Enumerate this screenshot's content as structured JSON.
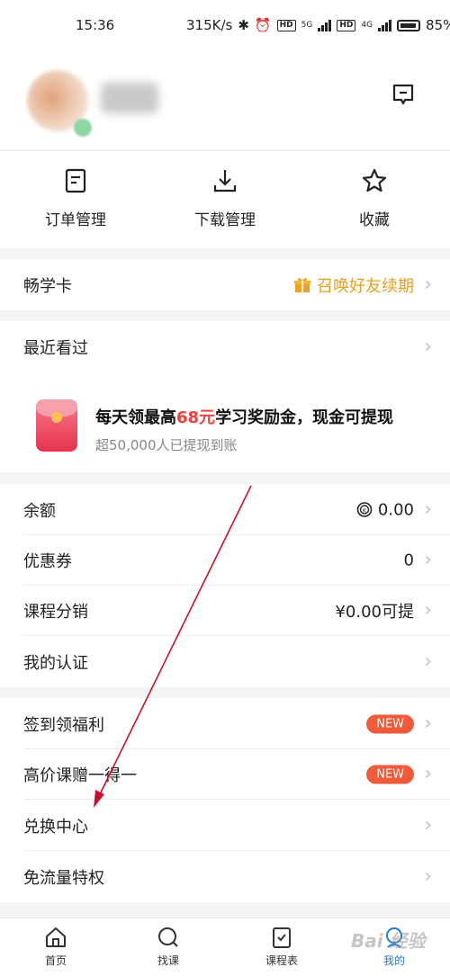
{
  "status_bar": {
    "time": "15:36",
    "speed": "315K/s",
    "net1": "5G",
    "net2": "4G",
    "hd": "HD",
    "battery": "85%"
  },
  "profile": {
    "username": "██"
  },
  "quick_actions": [
    {
      "label": "订单管理",
      "icon": "order-icon"
    },
    {
      "label": "下载管理",
      "icon": "download-icon"
    },
    {
      "label": "收藏",
      "icon": "star-icon"
    }
  ],
  "card": {
    "label": "畅学卡",
    "value": "召唤好友续期",
    "icon": "gift-icon"
  },
  "recent": {
    "label": "最近看过"
  },
  "promo": {
    "title_pre": "每天领最高",
    "title_hl": "68元",
    "title_post": "学习奖励金，现金可提现",
    "subtitle": "超50,000人已提现到账"
  },
  "wallet": [
    {
      "label": "余额",
      "value": "0.00",
      "icon": "coin-icon"
    },
    {
      "label": "优惠券",
      "value": "0"
    },
    {
      "label": "课程分销",
      "value": "¥0.00可提"
    },
    {
      "label": "我的认证",
      "value": ""
    }
  ],
  "benefits": [
    {
      "label": "签到领福利",
      "badge": "NEW"
    },
    {
      "label": "高价课赠一得一",
      "badge": "NEW"
    },
    {
      "label": "兑换中心",
      "badge": ""
    },
    {
      "label": "免流量特权",
      "badge": ""
    }
  ],
  "tabs": [
    {
      "label": "首页",
      "icon": "home-icon"
    },
    {
      "label": "找课",
      "icon": "search-icon"
    },
    {
      "label": "课程表",
      "icon": "schedule-icon"
    },
    {
      "label": "我的",
      "icon": "profile-icon",
      "active": true
    }
  ],
  "colors": {
    "accent_orange": "#e8a020",
    "badge_red": "#ef5a3a",
    "tab_active": "#1a7dd8",
    "highlight_red": "#f0413d"
  },
  "watermark": "Bai 经验"
}
